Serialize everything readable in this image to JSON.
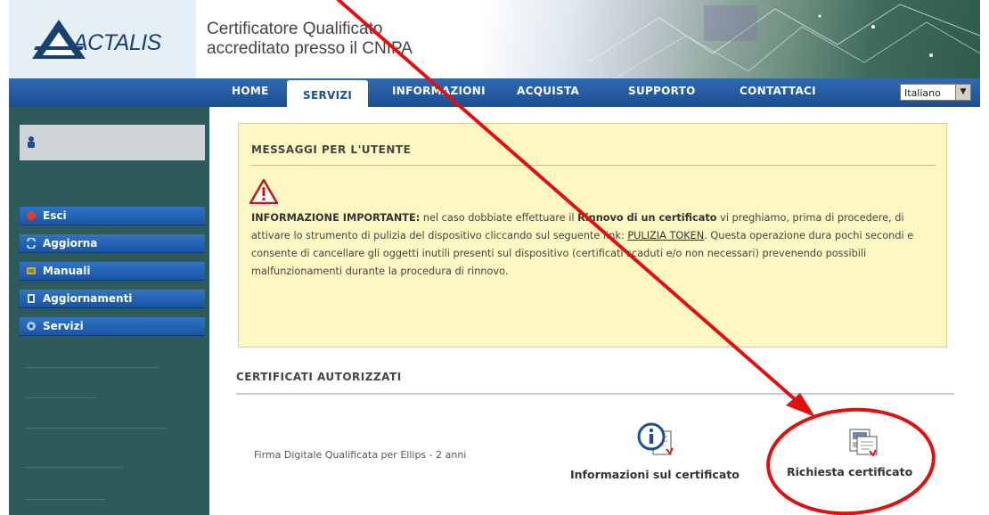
{
  "header": {
    "logo_text": "ACTALIS",
    "tagline_line1": "Certificatore Qualificato",
    "tagline_line2": "accreditato presso il CNIPA"
  },
  "nav": {
    "items": [
      {
        "label": "HOME"
      },
      {
        "label": "SERVIZI"
      },
      {
        "label": "INFORMAZIONI"
      },
      {
        "label": "ACQUISTA"
      },
      {
        "label": "SUPPORTO"
      },
      {
        "label": "CONTATTACI"
      }
    ],
    "active_index": 1,
    "language": "Italiano"
  },
  "sidebar": {
    "items": [
      {
        "label": "Esci",
        "icon": "exit-icon"
      },
      {
        "label": "Aggiorna",
        "icon": "refresh-icon"
      },
      {
        "label": "Manuali",
        "icon": "manuals-icon"
      },
      {
        "label": "Aggiornamenti",
        "icon": "updates-icon"
      },
      {
        "label": "Servizi",
        "icon": "services-icon"
      }
    ]
  },
  "messages": {
    "title": "MESSAGGI PER L'UTENTE",
    "important_label": "INFORMAZIONE IMPORTANTE:",
    "text_a": " nel caso dobbiate effettuare il ",
    "bold_renewal": "Rinnovo di un certificato",
    "text_b": " vi preghiamo, prima di procedere, di attivare lo strumento di pulizia del dispositivo cliccando sul seguente link: ",
    "link": "PULIZIA TOKEN",
    "text_c": ". Questa operazione dura pochi secondi e consente di cancellare gli oggetti inutili presenti sul dispositivo (certificati scaduti e/o non necessari) prevenendo possibili malfunzionamenti durante la procedura di rinnovo."
  },
  "certificates": {
    "title": "CERTIFICATI AUTORIZZATI",
    "item_name": "Firma Digitale Qualificata per Ellips - 2 anni",
    "info_label": "Informazioni sul certificato",
    "request_label": "Richiesta certificato"
  },
  "colors": {
    "nav_blue": "#1b4e92",
    "sidebar_teal": "#2f5a5c",
    "message_bg": "#fdf7c4",
    "annotation_red": "#e01010"
  }
}
